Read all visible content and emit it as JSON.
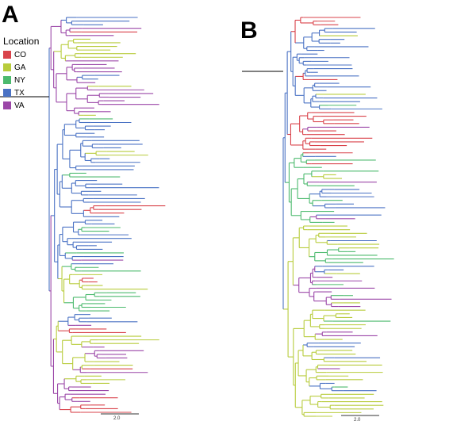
{
  "panels": [
    {
      "label": "A",
      "scale_bar_label": "2.0"
    },
    {
      "label": "B",
      "scale_bar_label": "2.0"
    }
  ],
  "legend": {
    "title": "Location",
    "items": [
      {
        "label": "CO",
        "color": "#d9434b"
      },
      {
        "label": "GA",
        "color": "#b8cc3c"
      },
      {
        "label": "NY",
        "color": "#4cba6e"
      },
      {
        "label": "TX",
        "color": "#4a72c4"
      },
      {
        "label": "VA",
        "color": "#9b47a8"
      }
    ]
  }
}
